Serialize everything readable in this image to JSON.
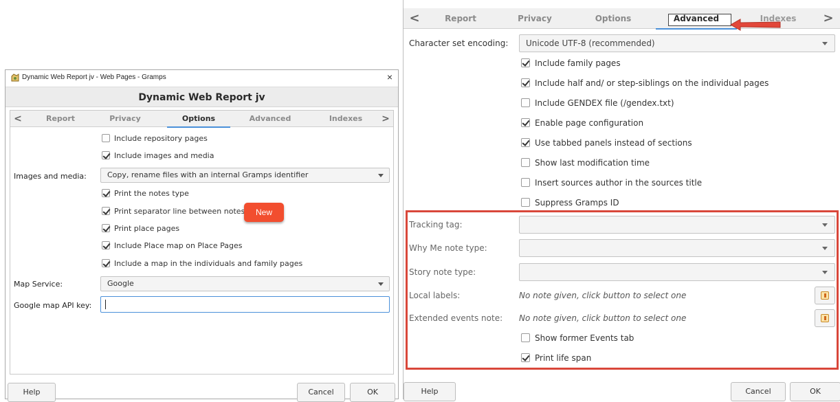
{
  "left_window": {
    "title": "Dynamic Web Report jv - Web Pages - Gramps",
    "close_glyph": "×",
    "header": "Dynamic Web Report jv",
    "tabs": [
      {
        "label": "Report",
        "active": false
      },
      {
        "label": "Privacy",
        "active": false
      },
      {
        "label": "Options",
        "active": true
      },
      {
        "label": "Advanced",
        "active": false
      },
      {
        "label": "Indexes",
        "active": false
      }
    ],
    "arrow_left": "<",
    "arrow_right": ">",
    "options": {
      "include_repository_pages": {
        "label": "Include repository pages",
        "checked": false
      },
      "include_images_media": {
        "label": "Include images and media",
        "checked": true
      },
      "images_media_label": "Images and media:",
      "images_media_value": "Copy, rename files with an internal Gramps identifier",
      "print_notes_type": {
        "label": "Print the notes type",
        "checked": true
      },
      "print_separator_line": {
        "label": "Print separator line between notes",
        "checked": true
      },
      "print_place_pages": {
        "label": "Print place pages",
        "checked": true
      },
      "include_place_map": {
        "label": "Include Place map on Place Pages",
        "checked": true
      },
      "include_map_individuals": {
        "label": "Include a map in the individuals and family pages",
        "checked": true
      },
      "map_service_label": "Map Service:",
      "map_service_value": "Google",
      "api_key_label": "Google map API key:",
      "api_key_value": ""
    },
    "badge": "New",
    "buttons": {
      "help": "Help",
      "cancel": "Cancel",
      "ok": "OK"
    }
  },
  "right_window": {
    "tabs": [
      {
        "label": "Report",
        "active": false
      },
      {
        "label": "Privacy",
        "active": false
      },
      {
        "label": "Options",
        "active": false
      },
      {
        "label": "Advanced",
        "active": true
      },
      {
        "label": "Indexes",
        "active": false
      }
    ],
    "arrow_left": "<",
    "arrow_right": ">",
    "charset_label": "Character set encoding:",
    "charset_value": "Unicode UTF-8 (recommended)",
    "checks": [
      {
        "label": "Include family pages",
        "checked": true
      },
      {
        "label": "Include half and/ or step-siblings on the individual pages",
        "checked": true
      },
      {
        "label": "Include GENDEX file (/gendex.txt)",
        "checked": false
      },
      {
        "label": "Enable page configuration",
        "checked": true
      },
      {
        "label": "Use tabbed panels instead of sections",
        "checked": true
      },
      {
        "label": "Show last modification time",
        "checked": false
      },
      {
        "label": "Insert sources author in the sources title",
        "checked": false
      },
      {
        "label": "Suppress Gramps ID",
        "checked": false
      }
    ],
    "tracking_tag_label": "Tracking tag:",
    "tracking_tag_value": "",
    "why_me_label": "Why Me note type:",
    "why_me_value": "",
    "story_note_label": "Story note type:",
    "story_note_value": "",
    "local_labels_label": "Local labels:",
    "local_labels_value": "No note given, click button to select one",
    "extended_events_label": "Extended events note:",
    "extended_events_value": "No note given, click button to select one",
    "show_former_events": {
      "label": "Show former Events tab",
      "checked": false
    },
    "print_life_span": {
      "label": "Print life span",
      "checked": true
    },
    "buttons": {
      "help": "Help",
      "cancel": "Cancel",
      "ok": "OK"
    }
  },
  "colors": {
    "highlight": "#d9473a",
    "badge": "#f24e2f",
    "active_tab_underline": "#4a90d9"
  }
}
